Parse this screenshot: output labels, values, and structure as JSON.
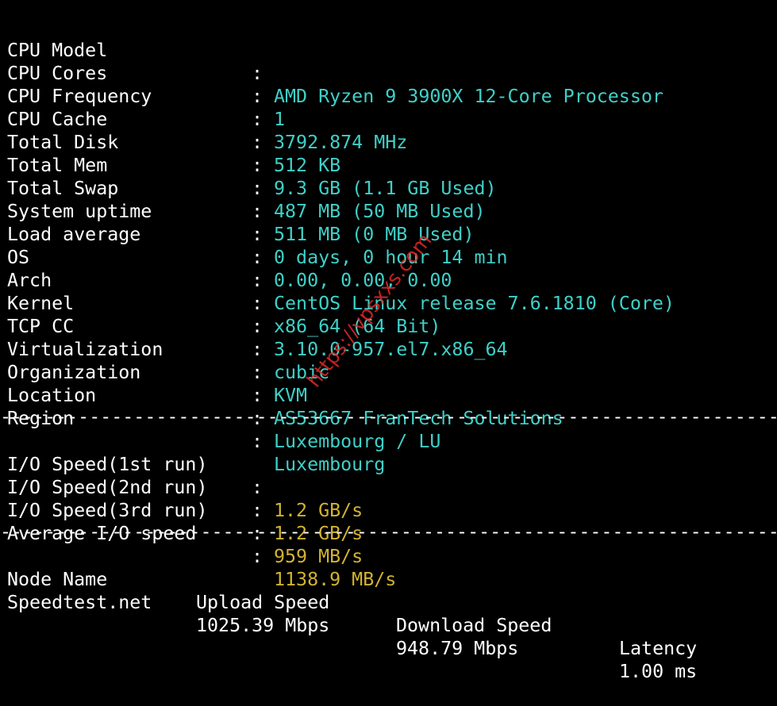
{
  "sysinfo": [
    {
      "key": "CPU Model",
      "value": "AMD Ryzen 9 3900X 12-Core Processor"
    },
    {
      "key": "CPU Cores",
      "value": "1"
    },
    {
      "key": "CPU Frequency",
      "value": "3792.874 MHz"
    },
    {
      "key": "CPU Cache",
      "value": "512 KB"
    },
    {
      "key": "Total Disk",
      "value": "9.3 GB (1.1 GB Used)"
    },
    {
      "key": "Total Mem",
      "value": "487 MB (50 MB Used)"
    },
    {
      "key": "Total Swap",
      "value": "511 MB (0 MB Used)"
    },
    {
      "key": "System uptime",
      "value": "0 days, 0 hour 14 min"
    },
    {
      "key": "Load average",
      "value": "0.00, 0.00, 0.00"
    },
    {
      "key": "OS",
      "value": "CentOS Linux release 7.6.1810 (Core)"
    },
    {
      "key": "Arch",
      "value": "x86_64 (64 Bit)"
    },
    {
      "key": "Kernel",
      "value": "3.10.0-957.el7.x86_64"
    },
    {
      "key": "TCP CC",
      "value": "cubic"
    },
    {
      "key": "Virtualization",
      "value": "KVM"
    },
    {
      "key": "Organization",
      "value": "AS53667 FranTech Solutions"
    },
    {
      "key": "Location",
      "value": "Luxembourg / LU"
    },
    {
      "key": "Region",
      "value": "Luxembourg"
    }
  ],
  "separator": ":",
  "divider": "----------------------------------------------------------------------",
  "io": [
    {
      "key": "I/O Speed(1st run)",
      "value": "1.2 GB/s"
    },
    {
      "key": "I/O Speed(2nd run)",
      "value": "1.2 GB/s"
    },
    {
      "key": "I/O Speed(3rd run)",
      "value": "959 MB/s"
    },
    {
      "key": "Average I/O speed",
      "value": "1138.9 MB/s"
    }
  ],
  "speedtest": {
    "headers": {
      "node": "Node Name",
      "upload": "Upload Speed",
      "download": "Download Speed",
      "latency": "Latency"
    },
    "rows": [
      {
        "node": "Speedtest.net",
        "upload": "1025.39 Mbps",
        "download": "948.79 Mbps",
        "latency": "1.00 ms"
      }
    ]
  },
  "watermark": "https://vpsxxs.com",
  "colors": {
    "background": "#000000",
    "label": "#ffffff",
    "sysinfo_value": "#3fd0c8",
    "io_value": "#d2b330",
    "node_name": "#d2b330",
    "upload": "#2e8b2e",
    "download": "#c21f1f",
    "latency": "#3fd0c8",
    "watermark": "#e62828"
  }
}
